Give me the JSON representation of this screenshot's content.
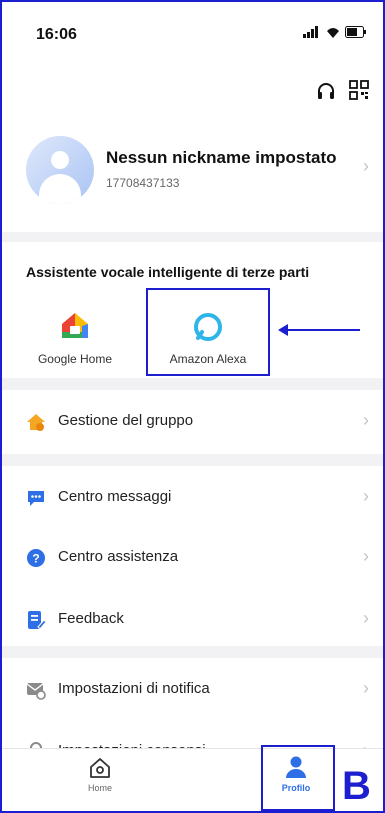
{
  "status_bar": {
    "time": "16:06"
  },
  "profile": {
    "name": "Nessun nickname impostato",
    "phone": "17708437133"
  },
  "assistants_section": {
    "title": "Assistente vocale intelligente di terze parti",
    "items": [
      {
        "label": "Google Home",
        "icon": "google-home-icon"
      },
      {
        "label": "Amazon Alexa",
        "icon": "alexa-icon"
      }
    ]
  },
  "menu": {
    "group_management": "Gestione del gruppo",
    "message_center": "Centro messaggi",
    "help_center": "Centro assistenza",
    "feedback": "Feedback",
    "notification_settings": "Impostazioni di notifica",
    "consent_settings": "Impostazioni consensi"
  },
  "tabbar": {
    "home": "Home",
    "profile": "Profilo"
  },
  "annotation": {
    "label": "B"
  },
  "colors": {
    "accent": "#1c1fd0",
    "brand_blue": "#2f6fe6",
    "orange": "#f5a623"
  }
}
